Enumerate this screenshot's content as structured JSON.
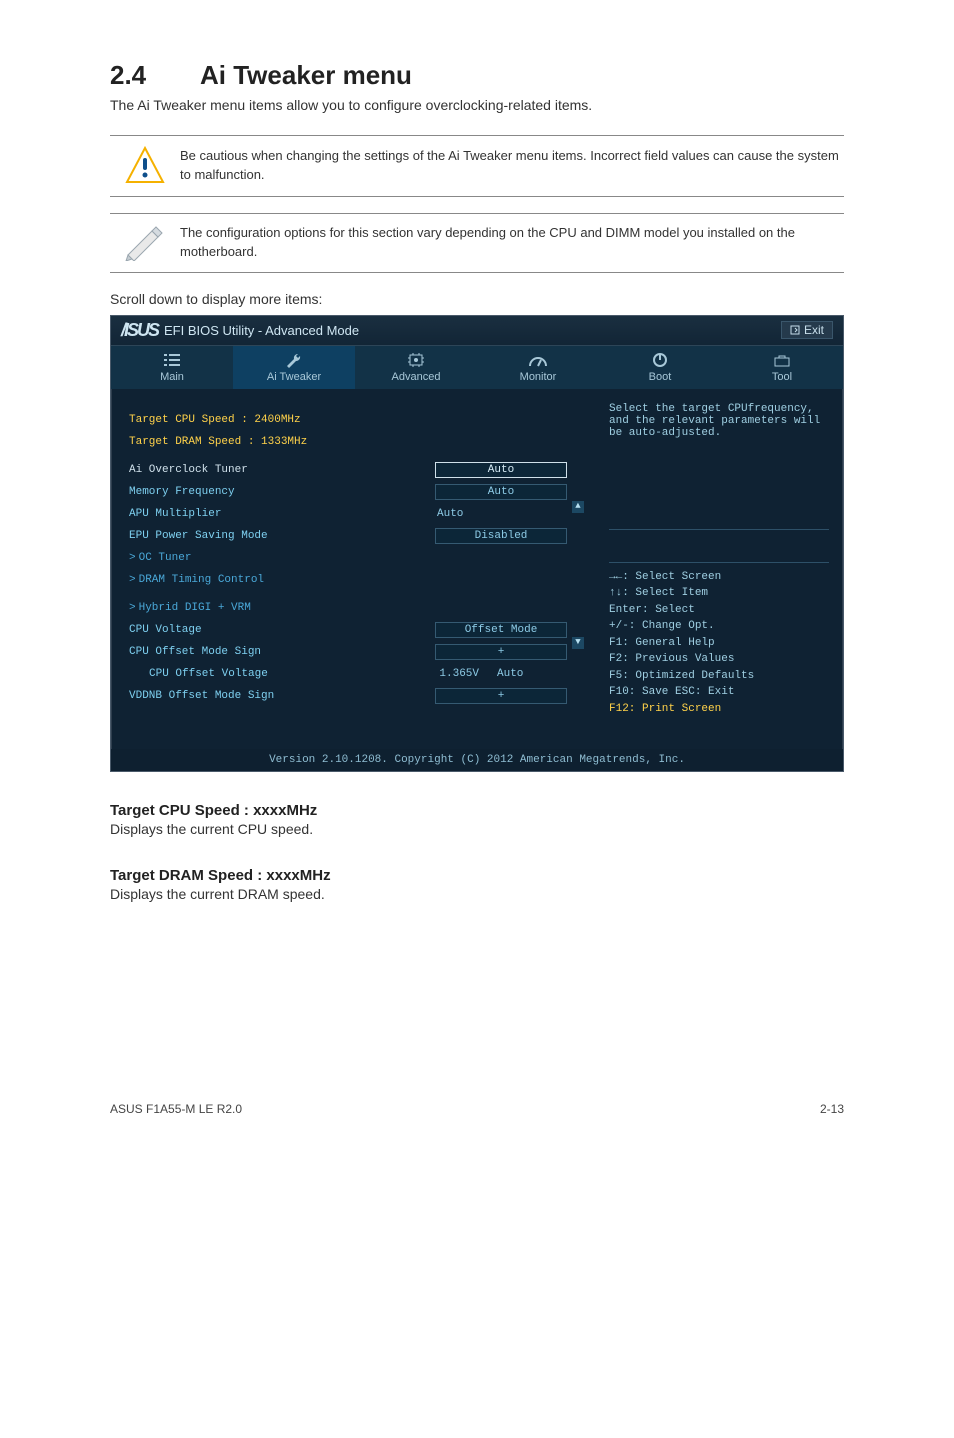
{
  "section": {
    "number": "2.4",
    "title": "Ai Tweaker menu"
  },
  "intro": "The Ai Tweaker menu items allow you to configure overclocking-related items.",
  "note_caution": "Be cautious when changing the settings of the Ai Tweaker menu items. Incorrect field values can cause the system to malfunction.",
  "note_info": "The configuration options for this section vary depending on the CPU and DIMM model you installed on the motherboard.",
  "scroll_hint": "Scroll down to display more items:",
  "bios": {
    "title_util": "EFI BIOS Utility - Advanced Mode",
    "exit": "Exit",
    "tabs": [
      "Main",
      "Ai Tweaker",
      "Advanced",
      "Monitor",
      "Boot",
      "Tool"
    ],
    "help_top": "Select the target CPUfrequency, and the relevant parameters will be auto-adjusted.",
    "help_keys": {
      "l1": "→←: Select Screen",
      "l2": "↑↓: Select Item",
      "l3": "Enter: Select",
      "l4": "+/-: Change Opt.",
      "l5": "F1: General Help",
      "l6": "F2: Previous Values",
      "l7": "F5: Optimized Defaults",
      "l8": "F10: Save  ESC: Exit",
      "l9": "F12: Print Screen"
    },
    "rows": {
      "target_cpu": "Target CPU Speed : 2400MHz",
      "target_dram": "Target DRAM Speed : 1333MHz",
      "ai_overclock": "Ai Overclock Tuner",
      "ai_overclock_v": "Auto",
      "mem_freq": "Memory Frequency",
      "mem_freq_v": "Auto",
      "apu_mult": "APU Multiplier",
      "apu_mult_v": "Auto",
      "epu": "EPU Power Saving Mode",
      "epu_v": "Disabled",
      "oc_tuner": "OC Tuner",
      "dram_timing": "DRAM Timing Control",
      "hybrid": "Hybrid DIGI + VRM",
      "cpu_voltage": "CPU Voltage",
      "cpu_voltage_v": "Offset Mode",
      "cpu_off_sign": "CPU Offset Mode Sign",
      "cpu_off_sign_v": "+",
      "cpu_off_volt": "CPU Offset Voltage",
      "cpu_off_volt_cur": "1.365V",
      "cpu_off_volt_v": "Auto",
      "vddnb_sign": "VDDNB Offset Mode Sign",
      "vddnb_sign_v": "+"
    },
    "footer": "Version 2.10.1208. Copyright (C) 2012 American Megatrends, Inc."
  },
  "sub1_h": "Target CPU Speed : xxxxMHz",
  "sub1_p": "Displays the current CPU speed.",
  "sub2_h": "Target DRAM Speed : xxxxMHz",
  "sub2_p": "Displays the current DRAM speed.",
  "footer_left": "ASUS F1A55-M LE R2.0",
  "footer_right": "2-13"
}
